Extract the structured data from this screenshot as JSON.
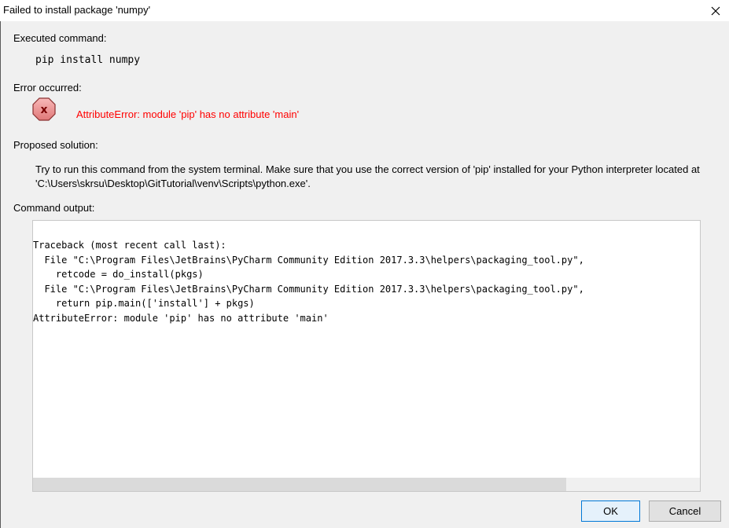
{
  "window": {
    "title": "Failed to install package 'numpy'",
    "close_icon": "close-icon"
  },
  "executed": {
    "label": "Executed command:",
    "command": "pip install numpy"
  },
  "error": {
    "label": "Error occurred:",
    "icon": "error-icon",
    "message": "AttributeError: module 'pip' has no attribute 'main'",
    "color": "#ff0000"
  },
  "solution": {
    "label": "Proposed solution:",
    "text": "Try to run this command from the system terminal. Make sure that you use the correct version of 'pip' installed for your Python interpreter located at 'C:\\Users\\skrsu\\Desktop\\GitTutorial\\venv\\Scripts\\python.exe'."
  },
  "output": {
    "label": "Command output:",
    "lines": [
      "Traceback (most recent call last):",
      "  File \"C:\\Program Files\\JetBrains\\PyCharm Community Edition 2017.3.3\\helpers\\packaging_tool.py\",",
      "    retcode = do_install(pkgs)",
      "  File \"C:\\Program Files\\JetBrains\\PyCharm Community Edition 2017.3.3\\helpers\\packaging_tool.py\",",
      "    return pip.main(['install'] + pkgs)",
      "AttributeError: module 'pip' has no attribute 'main'"
    ]
  },
  "buttons": {
    "ok": "OK",
    "cancel": "Cancel"
  }
}
